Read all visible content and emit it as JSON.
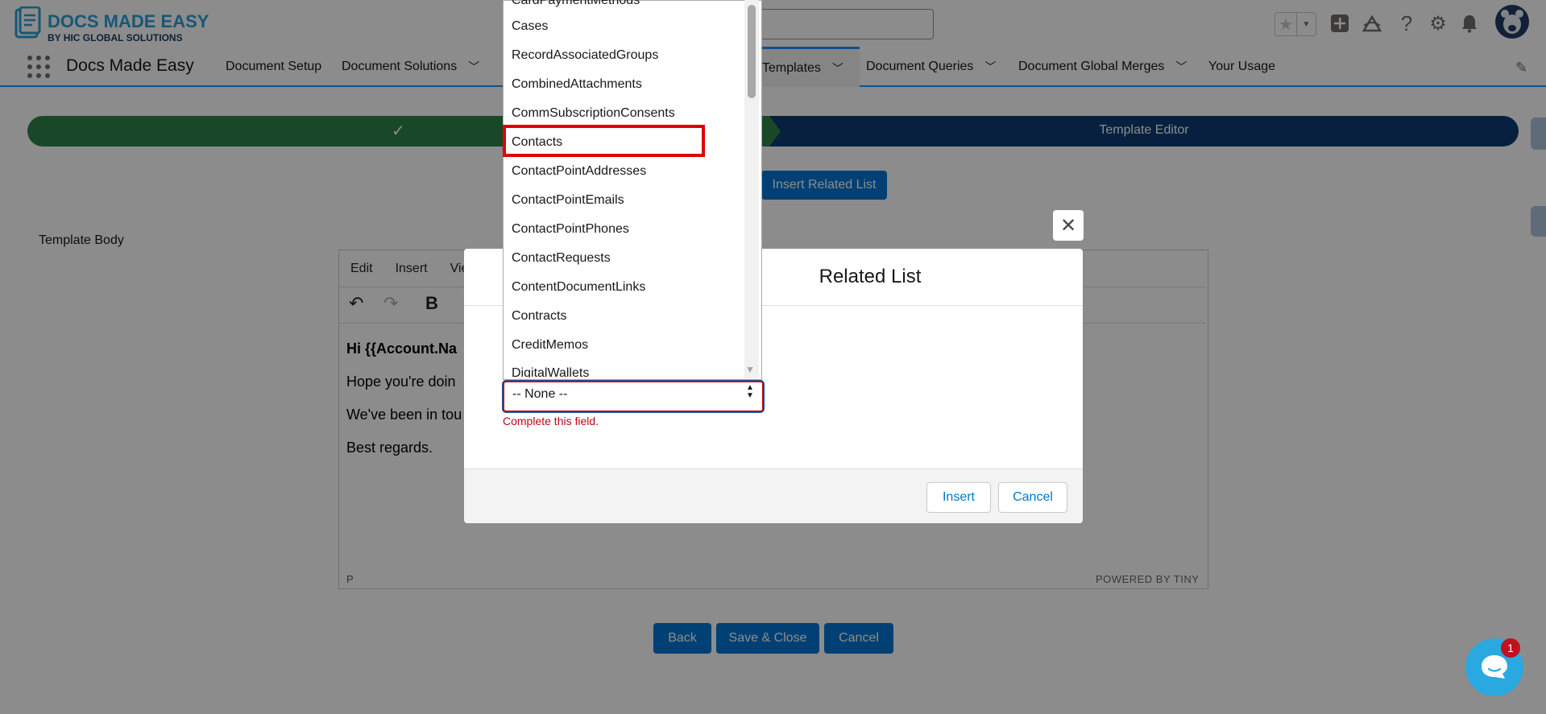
{
  "header": {
    "logo_title": "DOCS MADE EASY",
    "logo_subtitle": "BY HIC GLOBAL SOLUTIONS",
    "icons": [
      "star-icon",
      "add-icon",
      "trailhead-icon",
      "help-icon",
      "setup-gear-icon",
      "bell-icon",
      "avatar"
    ]
  },
  "nav": {
    "app_name": "Docs Made Easy",
    "items": [
      {
        "label": "Document Setup",
        "has_menu": false
      },
      {
        "label": "Document Solutions",
        "has_menu": true
      },
      {
        "label": "Templates",
        "has_menu": true,
        "active": true
      },
      {
        "label": "Document Queries",
        "has_menu": true
      },
      {
        "label": "Document Global Merges",
        "has_menu": true
      },
      {
        "label": "Your Usage",
        "has_menu": false
      }
    ]
  },
  "path": {
    "step2_label": "Template Editor"
  },
  "page": {
    "insert_related_button": "Insert Related List",
    "template_body_label": "Template Body"
  },
  "editor": {
    "menu": [
      "Edit",
      "Insert",
      "View"
    ],
    "lines": [
      "Hi {{Account.Na",
      "Hope you're doin",
      "We've been in tou",
      "Best regards."
    ],
    "status_element": "P",
    "powered_by": "POWERED BY TINY"
  },
  "bottom_buttons": {
    "back": "Back",
    "save_close": "Save & Close",
    "cancel": "Cancel"
  },
  "modal": {
    "title": "Related List",
    "select_value": "-- None --",
    "error": "Complete this field.",
    "insert": "Insert",
    "cancel": "Cancel"
  },
  "dropdown": {
    "options": [
      "CardPaymentMethods",
      "Cases",
      "RecordAssociatedGroups",
      "CombinedAttachments",
      "CommSubscriptionConsents",
      "Contacts",
      "ContactPointAddresses",
      "ContactPointEmails",
      "ContactPointPhones",
      "ContactRequests",
      "ContentDocumentLinks",
      "Contracts",
      "CreditMemos",
      "DigitalWallets"
    ],
    "highlighted": "Contacts"
  },
  "chat": {
    "badge_count": "1"
  },
  "colors": {
    "path_complete": "#2e844a",
    "path_current": "#0d3b74",
    "brand": "#0176d3",
    "error": "#ba0517",
    "highlight": "#e00000"
  }
}
